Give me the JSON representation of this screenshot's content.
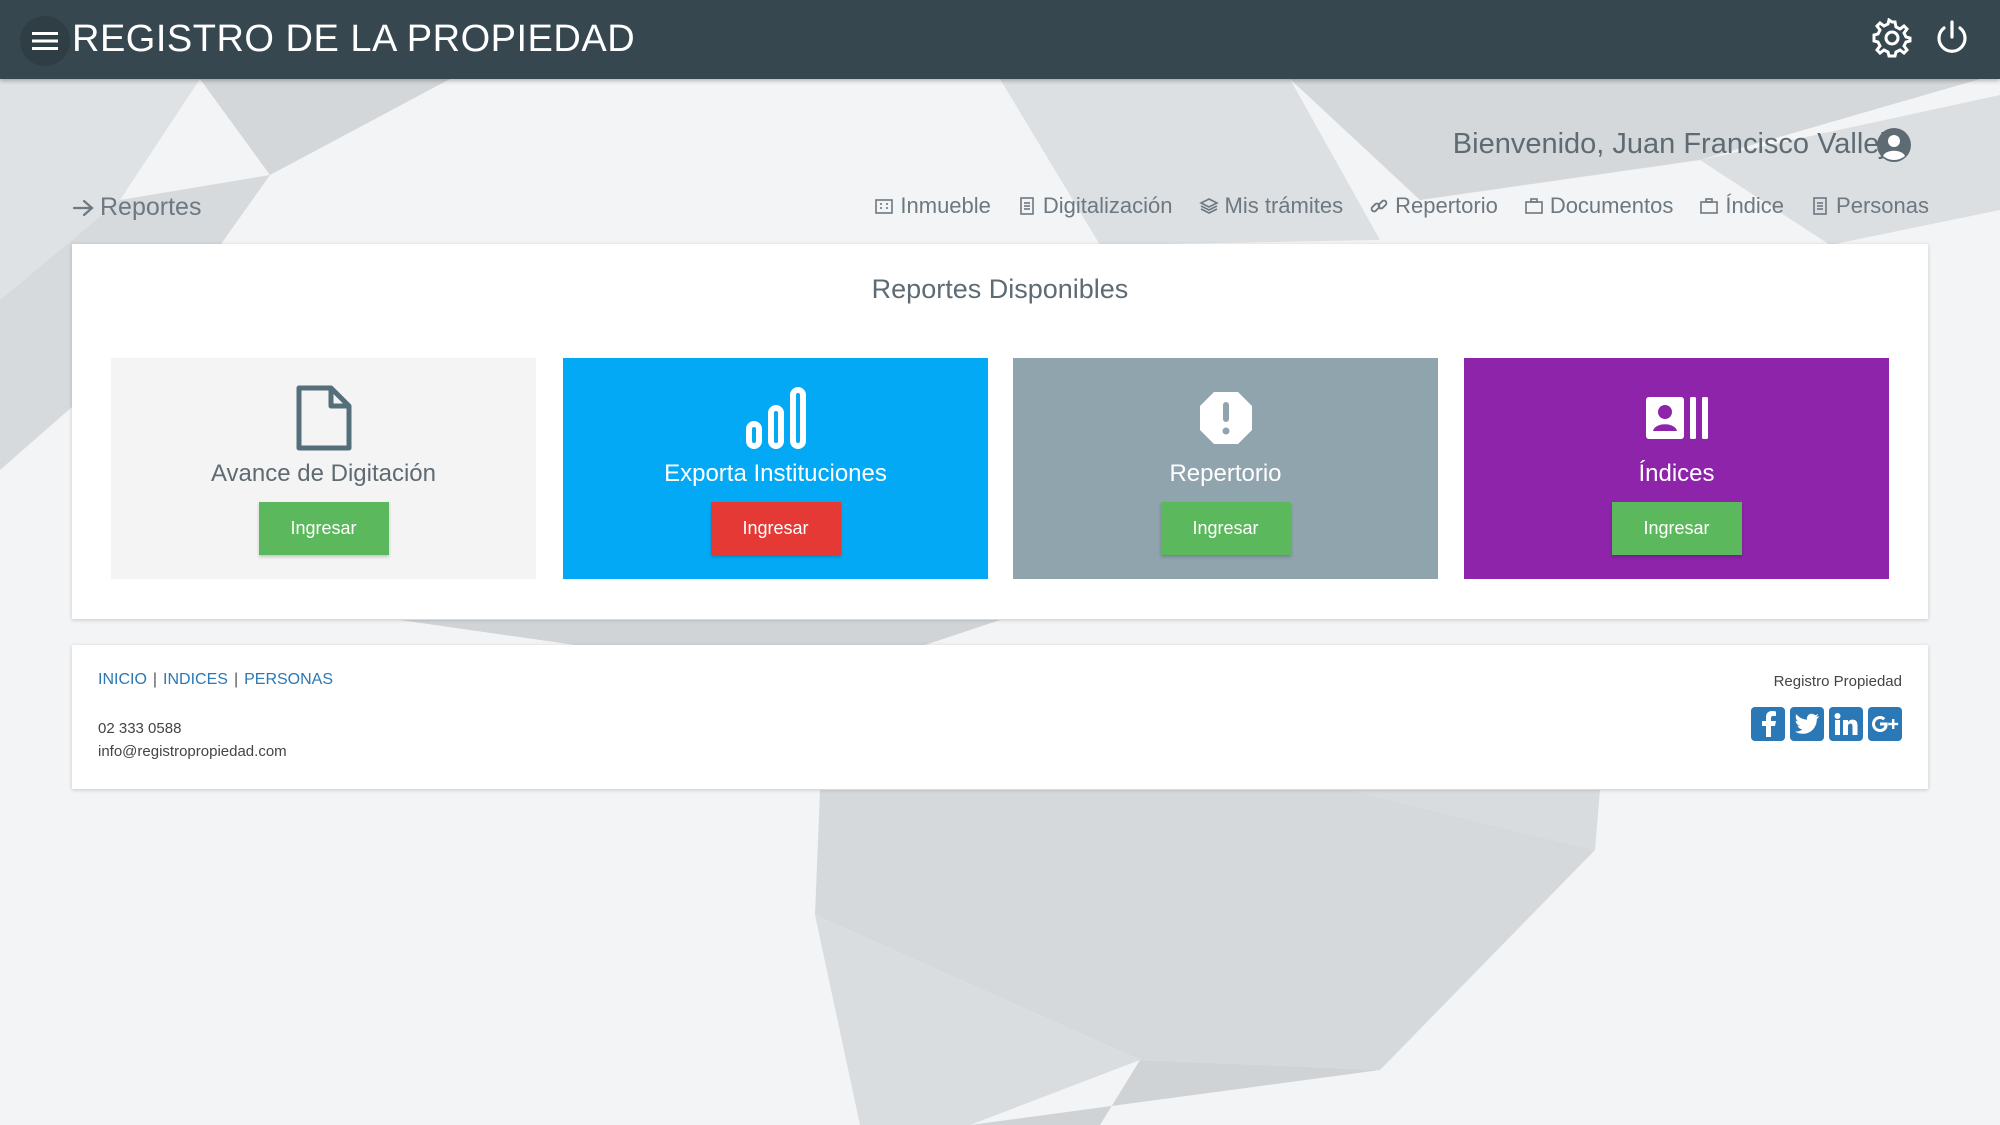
{
  "colors": {
    "topbar": "#37474f",
    "tile_light": "#f4f4f4",
    "tile_blue": "#03a9f4",
    "tile_gray": "#90a4ae",
    "tile_purple": "#8e24aa",
    "button_green": "#5cb85c",
    "button_red": "#e53935",
    "link_blue": "#2a78b5"
  },
  "topbar": {
    "title": "REGISTRO DE LA PROPIEDAD",
    "menu_icon": "hamburger-icon",
    "settings_icon": "gear-icon",
    "power_icon": "power-icon"
  },
  "user": {
    "welcome": "Bienvenido, Juan Francisco Vallejo",
    "icon": "user-circle-icon"
  },
  "breadcrumb": {
    "label": "Reportes",
    "icon": "arrow-right-icon"
  },
  "nav": {
    "items": [
      {
        "label": "Inmueble",
        "icon": "building-icon"
      },
      {
        "label": "Digitalización",
        "icon": "document-icon"
      },
      {
        "label": "Mis trámites",
        "icon": "layers-icon"
      },
      {
        "label": "Repertorio",
        "icon": "link-icon"
      },
      {
        "label": "Documentos",
        "icon": "briefcase-icon"
      },
      {
        "label": "Índice",
        "icon": "briefcase-icon"
      },
      {
        "label": "Personas",
        "icon": "document-icon"
      }
    ]
  },
  "reports": {
    "title": "Reportes Disponibles",
    "tiles": [
      {
        "label": "Avance de Digitación",
        "button": "Ingresar",
        "icon": "file-icon"
      },
      {
        "label": "Exporta Instituciones",
        "button": "Ingresar",
        "icon": "signal-bars-icon"
      },
      {
        "label": "Repertorio",
        "button": "Ingresar",
        "icon": "alert-octagon-icon"
      },
      {
        "label": "Índices",
        "button": "Ingresar",
        "icon": "contact-card-icon"
      }
    ]
  },
  "footer": {
    "links": [
      "INICIO",
      "INDICES",
      "PERSONAS"
    ],
    "separator": "|",
    "phone": "02 333 0588",
    "email": "info@registropropiedad.com",
    "brand": "Registro Propiedad",
    "social": [
      {
        "name": "facebook-icon",
        "glyph": "f"
      },
      {
        "name": "twitter-icon",
        "glyph": "t"
      },
      {
        "name": "linkedin-icon",
        "glyph": "in"
      },
      {
        "name": "google-plus-icon",
        "glyph": "G+"
      }
    ]
  }
}
